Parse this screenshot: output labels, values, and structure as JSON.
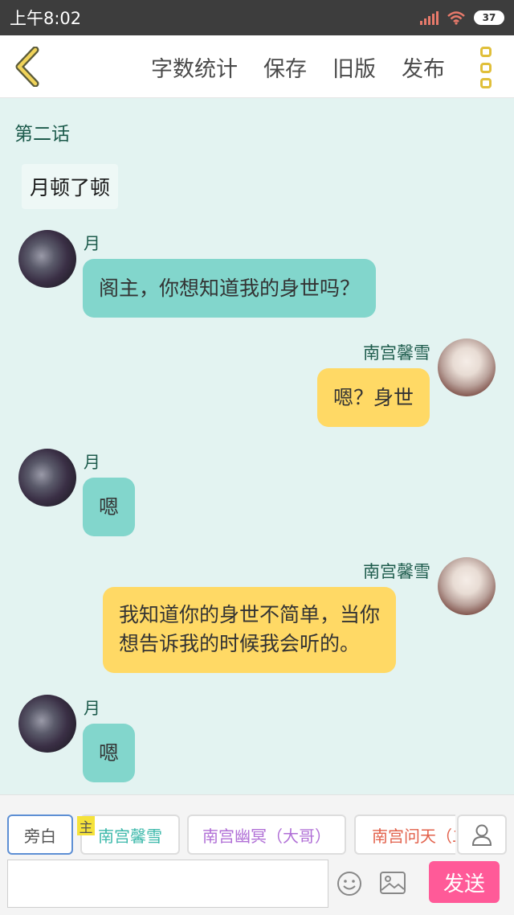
{
  "status_bar": {
    "time": "上午8:02",
    "battery": "37"
  },
  "nav": {
    "actions": [
      "字数统计",
      "保存",
      "旧版",
      "发布"
    ]
  },
  "chapter": {
    "title": "第二话"
  },
  "narration": "月顿了顿",
  "messages": [
    {
      "side": "left",
      "sender": "月",
      "text": "阁主，你想知道我的身世吗？"
    },
    {
      "side": "right",
      "sender": "南宫馨雪",
      "text": "嗯？身世"
    },
    {
      "side": "left",
      "sender": "月",
      "text": "嗯"
    },
    {
      "side": "right",
      "sender": "南宫馨雪",
      "text_line1": "我知道你的身世不简单，当你",
      "text_line2": "想告诉我的时候我会听的。"
    },
    {
      "side": "left",
      "sender": "月",
      "text": "嗯"
    }
  ],
  "roles": {
    "narrator": "旁白",
    "master_badge": "主",
    "role1": "南宫馨雪",
    "role2": "南宫幽冥（大哥）",
    "role3": "南宫问天（二"
  },
  "input": {
    "placeholder": ""
  },
  "send_label": "发送",
  "colors": {
    "bubble_left": "#82d6cc",
    "bubble_right": "#ffd965",
    "send": "#ff5a98",
    "role1": "#3bb8aa",
    "role2": "#b06fd6",
    "role3": "#e2604a"
  }
}
